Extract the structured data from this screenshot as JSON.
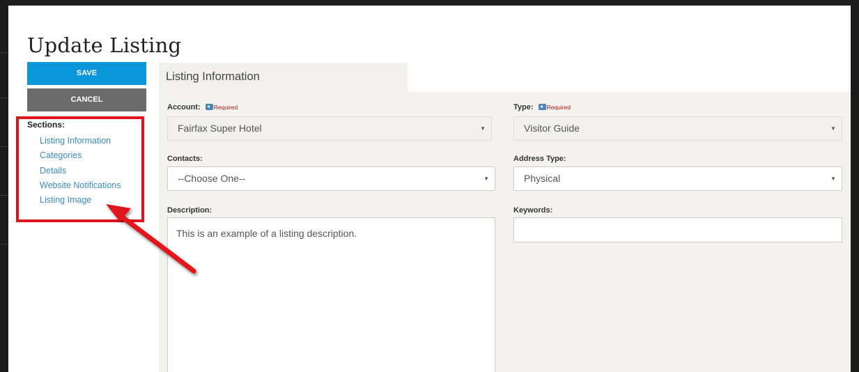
{
  "page": {
    "title": "Update Listing"
  },
  "actions": {
    "save_label": "SAVE",
    "cancel_label": "CANCEL"
  },
  "sections": {
    "label": "Sections:",
    "items": [
      {
        "label": "Listing Information"
      },
      {
        "label": "Categories"
      },
      {
        "label": "Details"
      },
      {
        "label": "Website Notifications"
      },
      {
        "label": "Listing Image"
      }
    ]
  },
  "tab": {
    "label": "Listing Information"
  },
  "form": {
    "account": {
      "label": "Account:",
      "required_text": "Required",
      "value": "Fairfax Super Hotel"
    },
    "type": {
      "label": "Type:",
      "required_text": "Required",
      "value": "Visitor Guide"
    },
    "contacts": {
      "label": "Contacts:",
      "value": "--Choose One--"
    },
    "address_type": {
      "label": "Address Type:",
      "value": "Physical"
    },
    "description": {
      "label": "Description:",
      "value": "This is an example of a listing description."
    },
    "keywords": {
      "label": "Keywords:",
      "value": ""
    }
  },
  "colors": {
    "save_button": "#0a97d9",
    "cancel_button": "#6b6b6b",
    "link": "#3a8cbf",
    "annotation": "#e0141c",
    "required": "#b01616"
  },
  "icons": {
    "caret": "chevron-down-icon",
    "required_flag": "required-flag-icon",
    "annotation_arrow": "annotation-arrow"
  }
}
